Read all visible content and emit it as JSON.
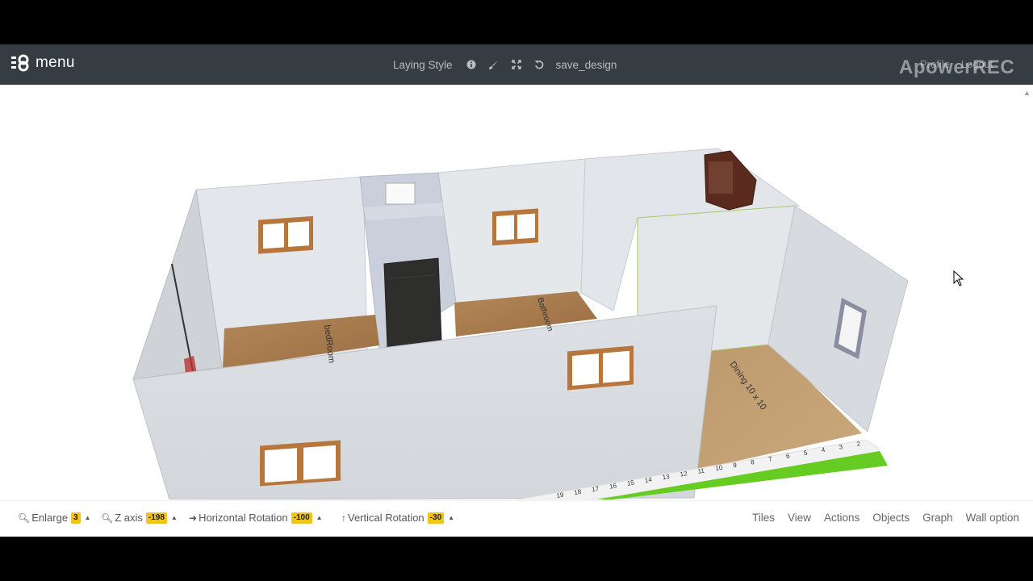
{
  "navbar": {
    "brand_label": "menu",
    "laying_style": "Laying Style",
    "save_design": "save_design",
    "profile": "Profile",
    "logout": "Logout",
    "watermark": "ApowerREC",
    "icons": [
      "info-icon",
      "brush-icon",
      "fullscreen-icon",
      "undo-icon"
    ]
  },
  "scene": {
    "room_labels": {
      "bedroom": "bedRoom",
      "bathroom": "Bathroom",
      "dining": "Dining 10 x 10"
    },
    "ruler_marks": [
      "2",
      "3",
      "4",
      "5",
      "6",
      "7",
      "8",
      "9",
      "10",
      "11",
      "12",
      "13",
      "14",
      "15",
      "16",
      "17",
      "18",
      "19"
    ]
  },
  "controls": {
    "enlarge": {
      "label": "Enlarge",
      "value": "3"
    },
    "z_axis": {
      "label": "Z axis",
      "value": "-198"
    },
    "horizontal_rotation": {
      "label": "Horizontal Rotation",
      "value": "-100"
    },
    "vertical_rotation": {
      "label": "Vertical Rotation",
      "value": "-30"
    }
  },
  "menu": {
    "tiles": "Tiles",
    "view": "View",
    "actions": "Actions",
    "objects": "Objects",
    "graph": "Graph",
    "wall_option": "Wall option"
  },
  "colors": {
    "navbar_bg": "#353c42",
    "badge": "#f0c419",
    "wall": "#d9dde2",
    "floor_wood": "#a97b4f",
    "ruler_green": "#66cc22"
  }
}
